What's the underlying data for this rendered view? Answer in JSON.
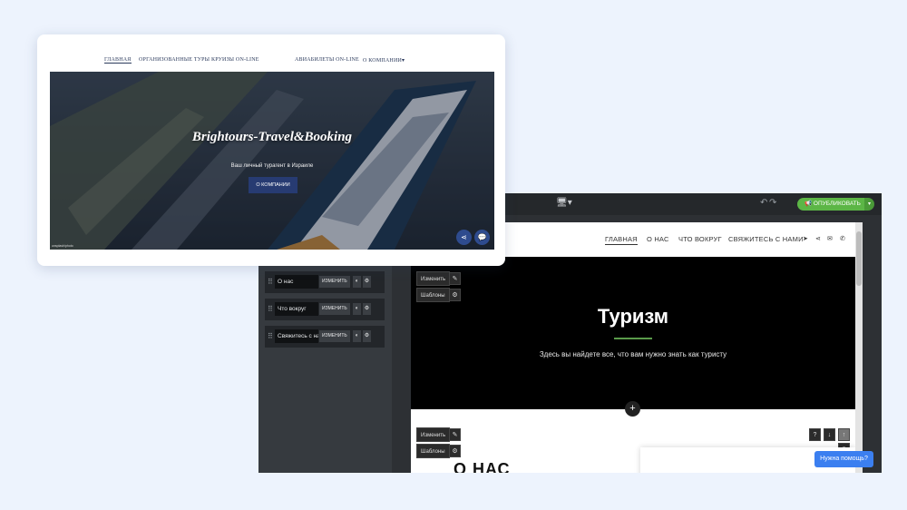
{
  "editor": {
    "publish_label": "ОПУБЛИКОВАТЬ",
    "icons": {
      "monitor": "monitor-icon",
      "undo": "undo-icon",
      "redo": "redo-icon",
      "publish_caret": "chevron-down-icon"
    },
    "sidebar": {
      "rows": [
        {
          "label": "О нас",
          "edit_label": "ИЗМЕНИТЬ"
        },
        {
          "label": "Что вокруг",
          "edit_label": "ИЗМЕНИТЬ"
        },
        {
          "label": "Свяжитесь с нами",
          "edit_label": "ИЗМЕНИТЬ"
        }
      ]
    },
    "preview": {
      "nav": [
        "ГЛАВНАЯ",
        "О НАС",
        "ЧТО ВОКРУГ",
        "СВЯЖИТЕСЬ С НАМИ"
      ],
      "hero_title": "Туризм",
      "hero_subtitle": "Здесь вы найдете все, что вам нужно знать как туристу",
      "edit_label": "Изменить",
      "templates_label": "Шаблоны",
      "section_heading": "О НАС",
      "accent_color": "#5a9a4a"
    },
    "help_label": "Нужна помощь?"
  },
  "site": {
    "nav": [
      "ГЛАВНАЯ",
      "ОРГАНИЗОВАННЫЕ ТУРЫ",
      "КРУИЗЫ ON-LINE",
      "АВИАБИЛЕТЫ ON-LINE",
      "О КОМПАНИИ"
    ],
    "nav_dropdown_caret": "▾",
    "title": "Brightours-Travel&Booking",
    "subtitle": "Ваш личный турагент в Израиле",
    "cta_label": "О КОМПАНИИ",
    "photo_credit": "unsplash/photo",
    "brand_color": "#273b72",
    "icons": {
      "share": "share-icon",
      "chat": "chat-icon"
    }
  }
}
